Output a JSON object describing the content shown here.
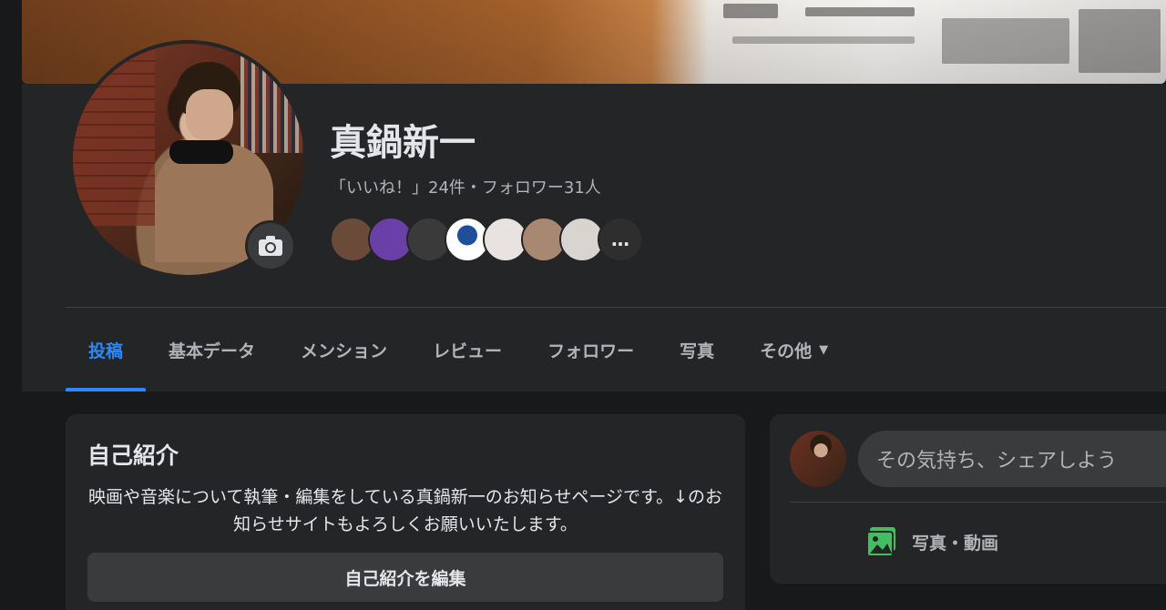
{
  "profile": {
    "name": "真鍋新一",
    "stats": "「いいね！」24件・フォロワー31人"
  },
  "friends": {
    "colors": [
      "#6a4b3a",
      "#6a3fa8",
      "#3a3a3a",
      "#ffffff",
      "#e8e2e0",
      "#a88870",
      "#d8d4d0",
      "#2e2e2e"
    ],
    "more_label": "…"
  },
  "tabs": [
    {
      "label": "投稿",
      "active": true
    },
    {
      "label": "基本データ"
    },
    {
      "label": "メンション"
    },
    {
      "label": "レビュー"
    },
    {
      "label": "フォロワー"
    },
    {
      "label": "写真"
    },
    {
      "label": "その他"
    }
  ],
  "intro": {
    "title": "自己紹介",
    "text": "映画や音楽について執筆・編集をしている真鍋新一のお知らせページです。↓のお知らせサイトもよろしくお願いいたします。",
    "edit_button": "自己紹介を編集"
  },
  "composer": {
    "placeholder": "その気持ち、シェアしよう",
    "media_label": "写真・動画"
  },
  "colors": {
    "accent": "#2d88ff",
    "panel": "#242526",
    "background": "#18191a",
    "media_green": "#45bd62"
  }
}
